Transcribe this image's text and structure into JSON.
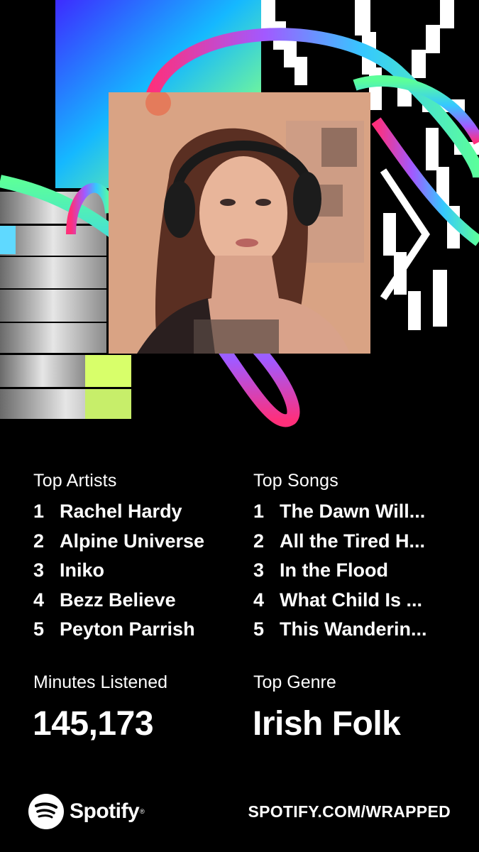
{
  "photo": {
    "alt": "Artist portrait with headphones"
  },
  "top_artists": {
    "heading": "Top Artists",
    "items": [
      {
        "rank": "1",
        "name": "Rachel Hardy"
      },
      {
        "rank": "2",
        "name": "Alpine Universe"
      },
      {
        "rank": "3",
        "name": "Iniko"
      },
      {
        "rank": "4",
        "name": "Bezz Believe"
      },
      {
        "rank": "5",
        "name": "Peyton Parrish"
      }
    ]
  },
  "top_songs": {
    "heading": "Top Songs",
    "items": [
      {
        "rank": "1",
        "name": "The Dawn Will..."
      },
      {
        "rank": "2",
        "name": "All the Tired H..."
      },
      {
        "rank": "3",
        "name": "In the Flood"
      },
      {
        "rank": "4",
        "name": "What Child Is ..."
      },
      {
        "rank": "5",
        "name": "This Wanderin..."
      }
    ]
  },
  "minutes": {
    "label": "Minutes Listened",
    "value": "145,173"
  },
  "genre": {
    "label": "Top Genre",
    "value": "Irish Folk"
  },
  "footer": {
    "brand": "Spotify",
    "url": "SPOTIFY.COM/WRAPPED"
  },
  "colors": {
    "background": "#000000",
    "text": "#ffffff",
    "brand": "#1DB954"
  }
}
